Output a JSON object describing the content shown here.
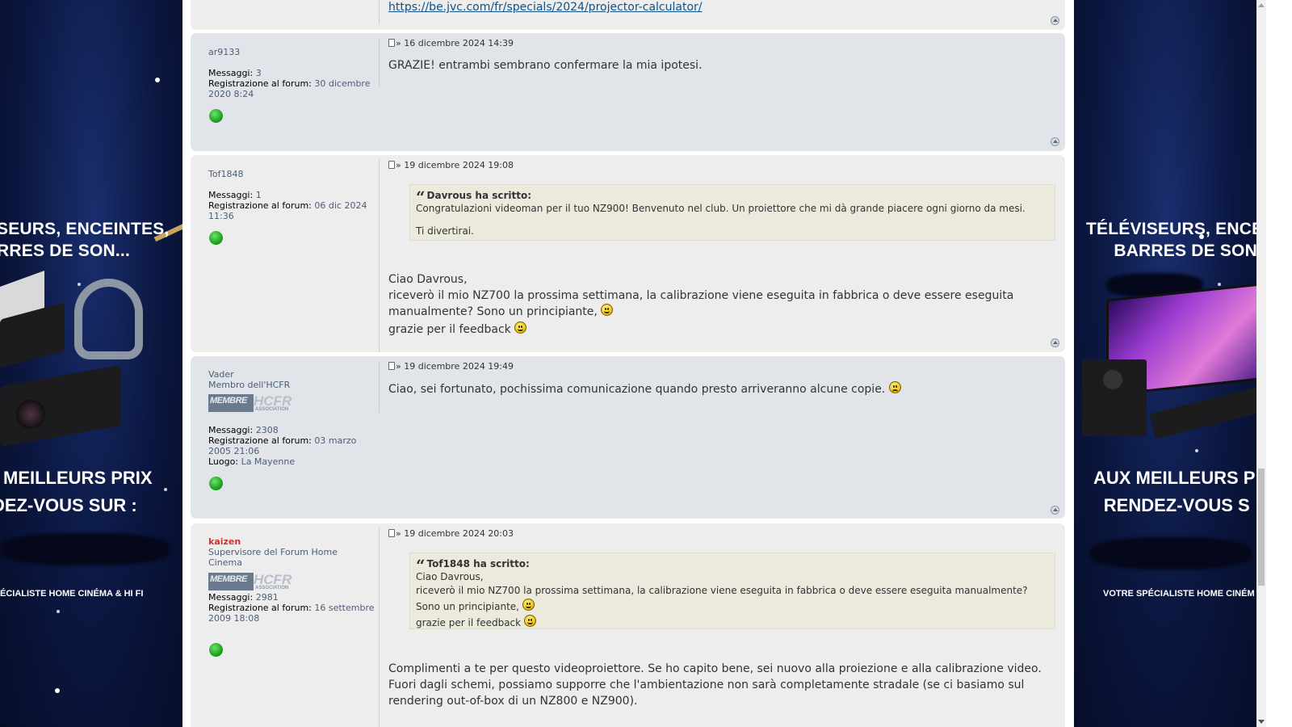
{
  "ads": {
    "left": {
      "headline_1": "SEURS, ENCEINTES,",
      "headline_2": "RRES DE SON...",
      "cta_1": "MEILLEURS PRIX",
      "cta_2": "DEZ-VOUS SUR :",
      "footer": "ÉCIALISTE HOME CINÉMA & HI FI"
    },
    "right": {
      "headline_1": "TÉLÉVISEURS, ENCE",
      "headline_2": "BARRES DE SON",
      "cta_1": "AUX MEILLEURS P",
      "cta_2": "RENDEZ-VOUS S",
      "footer": "VOTRE SPÉCIALISTE HOME CINÉM"
    }
  },
  "labels": {
    "messages": "Messaggi:",
    "registered": "Registrazione al forum:",
    "location": "Luogo:",
    "rank_image_a": "MEMBRE",
    "rank_image_b": "HCFR",
    "rank_image_c": "ASSOCIATION"
  },
  "top_post": {
    "link": "https://be.jvc.com/fr/specials/2024/projector-calculator/"
  },
  "posts": [
    {
      "author": "ar9133",
      "messages": "3",
      "registered": "30 dicembre 2020 8:24",
      "date": "» 16 dicembre 2024 14:39",
      "text": "GRAZIE! entrambi sembrano confermare la mia ipotesi."
    },
    {
      "author": "Tof1848",
      "messages": "1",
      "registered": "06 dic 2024 11:36",
      "date": "» 19 dicembre 2024 19:08",
      "quote_author": "Davrous ha scritto:",
      "quote_line_1": "Congratulazioni videoman per il tuo NZ900! Benvenuto nel club. Un proiettore che mi dà grande piacere ogni giorno da mesi.",
      "quote_line_2": "Ti divertirai.",
      "text_1": "Ciao Davrous,",
      "text_2": "riceverò il mio NZ700 la prossima settimana, la calibrazione viene eseguita in fabbrica o deve essere eseguita manualmente? Sono un principiante,",
      "text_3": "grazie per il feedback"
    },
    {
      "author": "Vader",
      "rank": "Membro dell'HCFR",
      "messages": "2308",
      "registered": "03 marzo 2005 21:06",
      "location": "La Mayenne",
      "date": "» 19 dicembre 2024 19:49",
      "text": "Ciao, sei fortunato, pochissima comunicazione quando presto arriveranno alcune copie."
    },
    {
      "author": "kaizen",
      "rank": "Supervisore del Forum Home Cinema",
      "messages": "2981",
      "registered": "16 settembre 2009 18:08",
      "date": "» 19 dicembre 2024 20:03",
      "quote_author": "Tof1848 ha scritto:",
      "quote_line_1": "Ciao Davrous,",
      "quote_line_2": "riceverò il mio NZ700 la prossima settimana, la calibrazione viene eseguita in fabbrica o deve essere eseguita manualmente? Sono un principiante,",
      "quote_line_3": "grazie per il feedback",
      "text_1": "Complimenti a te per questo videoproiettore. Se ho capito bene, sei nuovo alla proiezione e alla calibrazione video.",
      "text_2": "Fuori dagli schemi, possiamo supporre che l'ambientazione non sarà completamente stradale (se ci basiamo sul rendering out-of-box di un NZ800 e NZ900)."
    }
  ],
  "colors": {
    "post_bg_blue": "#e1e5ea",
    "post_bg_grey": "#ededed",
    "link": "#105289",
    "moderator": "#cc3333",
    "quote_bg": "#ebeadd"
  },
  "icons": [
    "post-icon",
    "online-indicator-icon",
    "back-to-top-icon",
    "laughing-smiley-icon",
    "wink-smiley-icon",
    "sad-smiley-icon"
  ]
}
